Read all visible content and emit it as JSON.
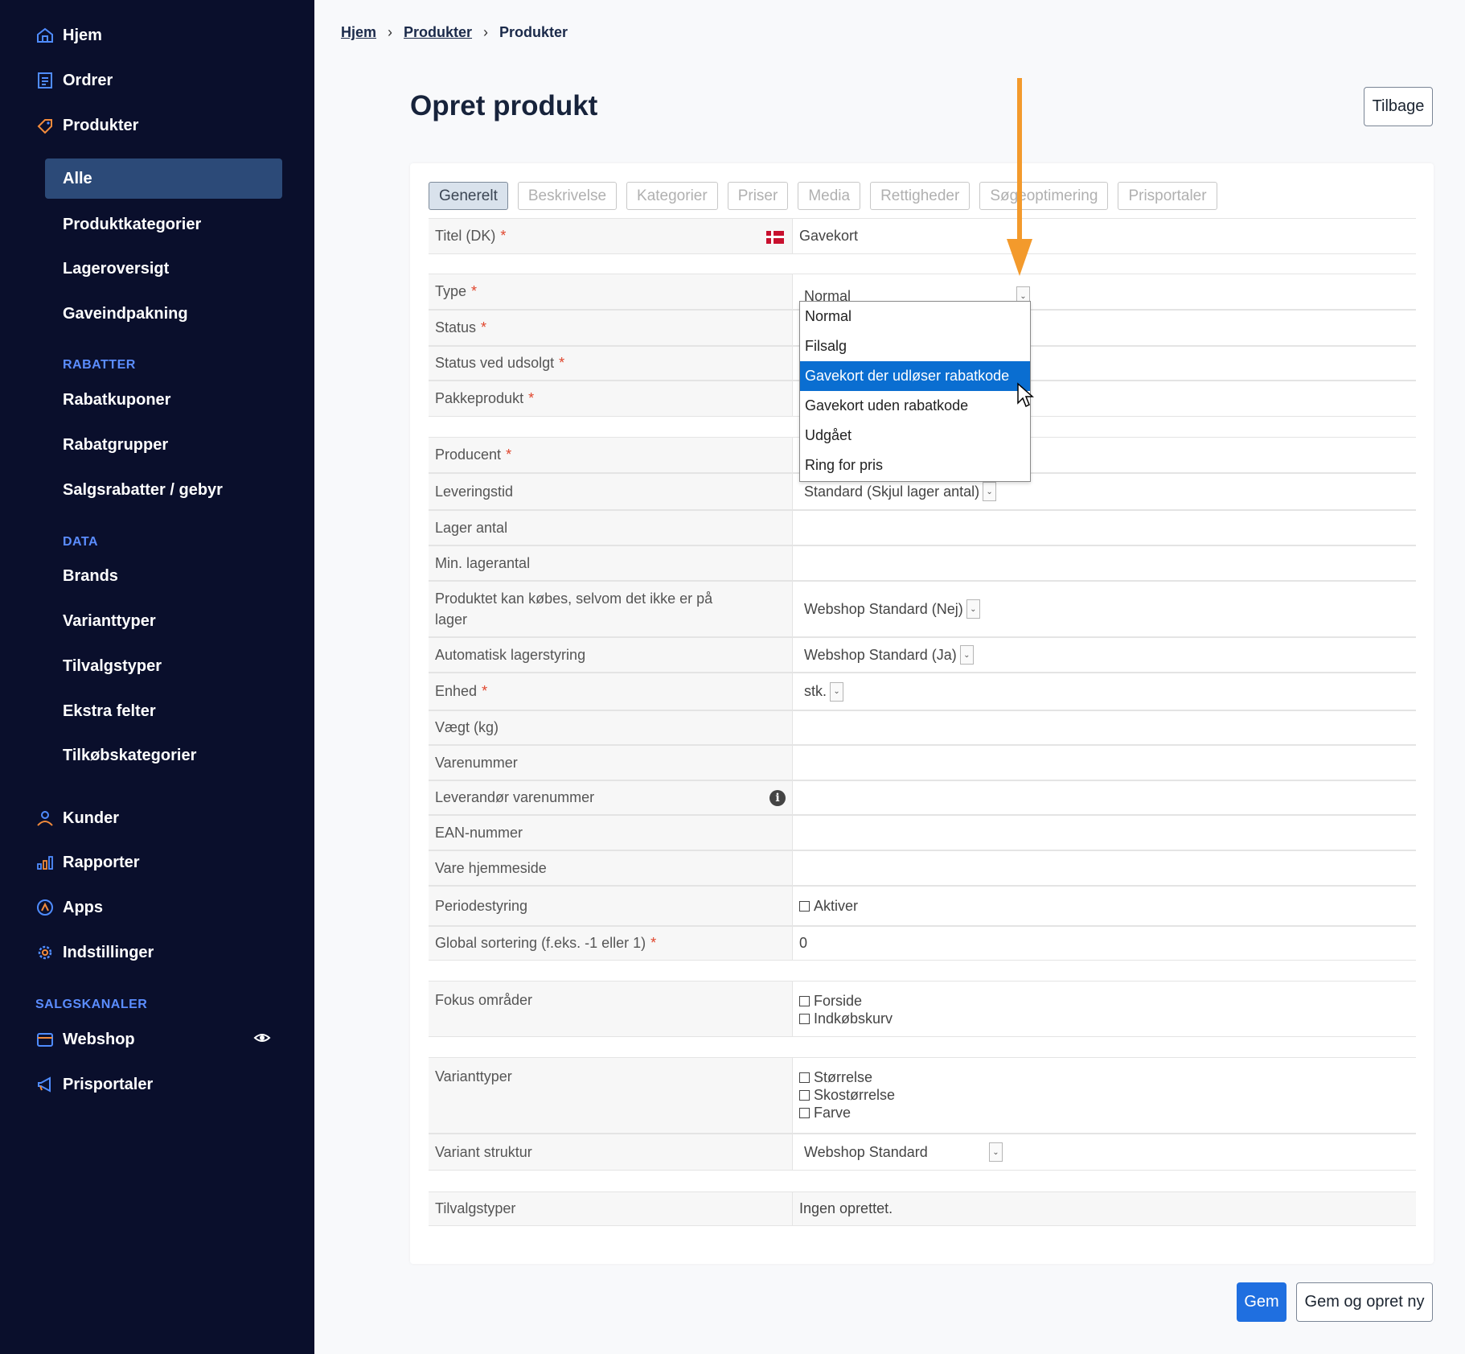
{
  "sidebar": {
    "main_items": [
      {
        "label": "Hjem",
        "icon": "home-icon"
      },
      {
        "label": "Ordrer",
        "icon": "orders-icon"
      },
      {
        "label": "Produkter",
        "icon": "tag-icon"
      }
    ],
    "product_sub": [
      "Alle",
      "Produktkategorier",
      "Lageroversigt",
      "Gaveindpakning"
    ],
    "section_rabatter": "RABATTER",
    "rabatter_items": [
      "Rabatkuponer",
      "Rabatgrupper",
      "Salgsrabatter / gebyr"
    ],
    "section_data": "DATA",
    "data_items": [
      "Brands",
      "Varianttyper",
      "Tilvalgstyper",
      "Ekstra felter",
      "Tilkøbskategorier"
    ],
    "lower_items": [
      {
        "label": "Kunder",
        "icon": "user-icon"
      },
      {
        "label": "Rapporter",
        "icon": "bar-chart-icon"
      },
      {
        "label": "Apps",
        "icon": "apps-icon"
      },
      {
        "label": "Indstillinger",
        "icon": "gear-icon"
      }
    ],
    "section_salgskanaler": "SALGSKANALER",
    "channel_items": [
      {
        "label": "Webshop",
        "icon": "webshop-icon"
      },
      {
        "label": "Prisportaler",
        "icon": "megaphone-icon"
      }
    ]
  },
  "breadcrumb": [
    "Hjem",
    "Produkter",
    "Produkter"
  ],
  "page_title": "Opret produkt",
  "back_button": "Tilbage",
  "tabs": [
    "Generelt",
    "Beskrivelse",
    "Kategorier",
    "Priser",
    "Media",
    "Rettigheder",
    "Søgeoptimering",
    "Prisportaler"
  ],
  "form": {
    "titel_label": "Titel (DK)",
    "titel_value": "Gavekort",
    "type_label": "Type",
    "type_value": "Normal",
    "status_label": "Status",
    "status_udsolgt_label": "Status ved udsolgt",
    "pakkeprodukt_label": "Pakkeprodukt",
    "producent_label": "Producent",
    "leveringstid_label": "Leveringstid",
    "leveringstid_value": "Standard (Skjul lager antal)",
    "lager_antal_label": "Lager antal",
    "min_lagerantal_label": "Min. lagerantal",
    "kobes_label": "Produktet kan købes, selvom det ikke er på lager",
    "kobes_value": "Webshop Standard (Nej)",
    "auto_lager_label": "Automatisk lagerstyring",
    "auto_lager_value": "Webshop Standard (Ja)",
    "enhed_label": "Enhed",
    "enhed_value": "stk.",
    "vaegt_label": "Vægt (kg)",
    "varenummer_label": "Varenummer",
    "lev_varenummer_label": "Leverandør varenummer",
    "ean_label": "EAN-nummer",
    "hjemmeside_label": "Vare hjemmeside",
    "periode_label": "Periodestyring",
    "periode_checkbox": "Aktiver",
    "sortering_label": "Global sortering (f.eks. -1 eller 1)",
    "sortering_value": "0",
    "fokus_label": "Fokus områder",
    "fokus_options": [
      "Forside",
      "Indkøbskurv"
    ],
    "varianttyper_label": "Varianttyper",
    "varianttyper_options": [
      "Størrelse",
      "Skostørrelse",
      "Farve"
    ],
    "variant_struktur_label": "Variant struktur",
    "variant_struktur_value": "Webshop Standard",
    "tilvalgstyper_label": "Tilvalgstyper",
    "tilvalgstyper_value": "Ingen oprettet."
  },
  "type_dropdown": {
    "options": [
      "Normal",
      "Filsalg",
      "Gavekort der udløser rabatkode",
      "Gavekort uden rabatkode",
      "Udgået",
      "Ring for pris"
    ],
    "highlighted": "Gavekort der udløser rabatkode"
  },
  "buttons": {
    "save": "Gem",
    "save_new": "Gem og opret ny"
  },
  "colors": {
    "sidebar_bg": "#0a0f2c",
    "active_item": "#2c4a78",
    "accent": "#1f6fe0",
    "annotation_arrow": "#f39a2c",
    "required": "#e0452c"
  }
}
